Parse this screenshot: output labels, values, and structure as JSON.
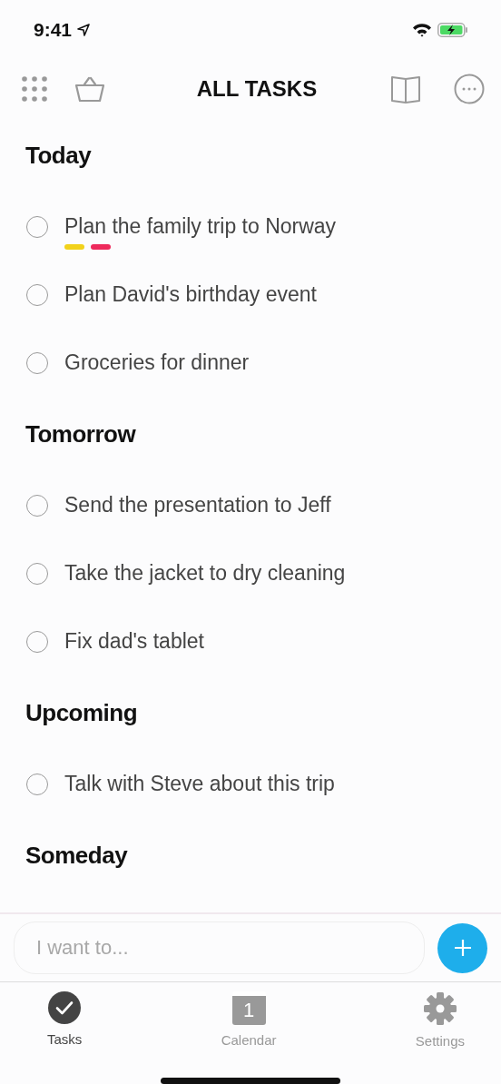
{
  "status_bar": {
    "time": "9:41"
  },
  "toolbar": {
    "title": "ALL TASKS"
  },
  "sections": [
    {
      "heading": "Today",
      "tasks": [
        {
          "title": "Plan the family trip to Norway",
          "checked": false,
          "tags": [
            {
              "color": "#f2d21b"
            },
            {
              "color": "#ee2a5c"
            }
          ]
        },
        {
          "title": "Plan David's birthday event",
          "checked": false
        },
        {
          "title": "Groceries for dinner",
          "checked": false
        }
      ]
    },
    {
      "heading": "Tomorrow",
      "tasks": [
        {
          "title": "Send the presentation to Jeff",
          "checked": false
        },
        {
          "title": "Take the jacket to dry cleaning",
          "checked": false
        },
        {
          "title": "Fix dad's tablet",
          "checked": false
        }
      ]
    },
    {
      "heading": "Upcoming",
      "tasks": [
        {
          "title": "Talk with Steve about this trip",
          "checked": false
        }
      ]
    },
    {
      "heading": "Someday"
    }
  ],
  "composer": {
    "placeholder": "I want to..."
  },
  "tab_bar": [
    {
      "kind": "tasks",
      "label": "Tasks",
      "selected": true
    },
    {
      "kind": "calendar",
      "label": "Calendar",
      "selected": false,
      "icon_text": "1"
    },
    {
      "kind": "settings",
      "label": "Settings",
      "selected": false
    }
  ]
}
